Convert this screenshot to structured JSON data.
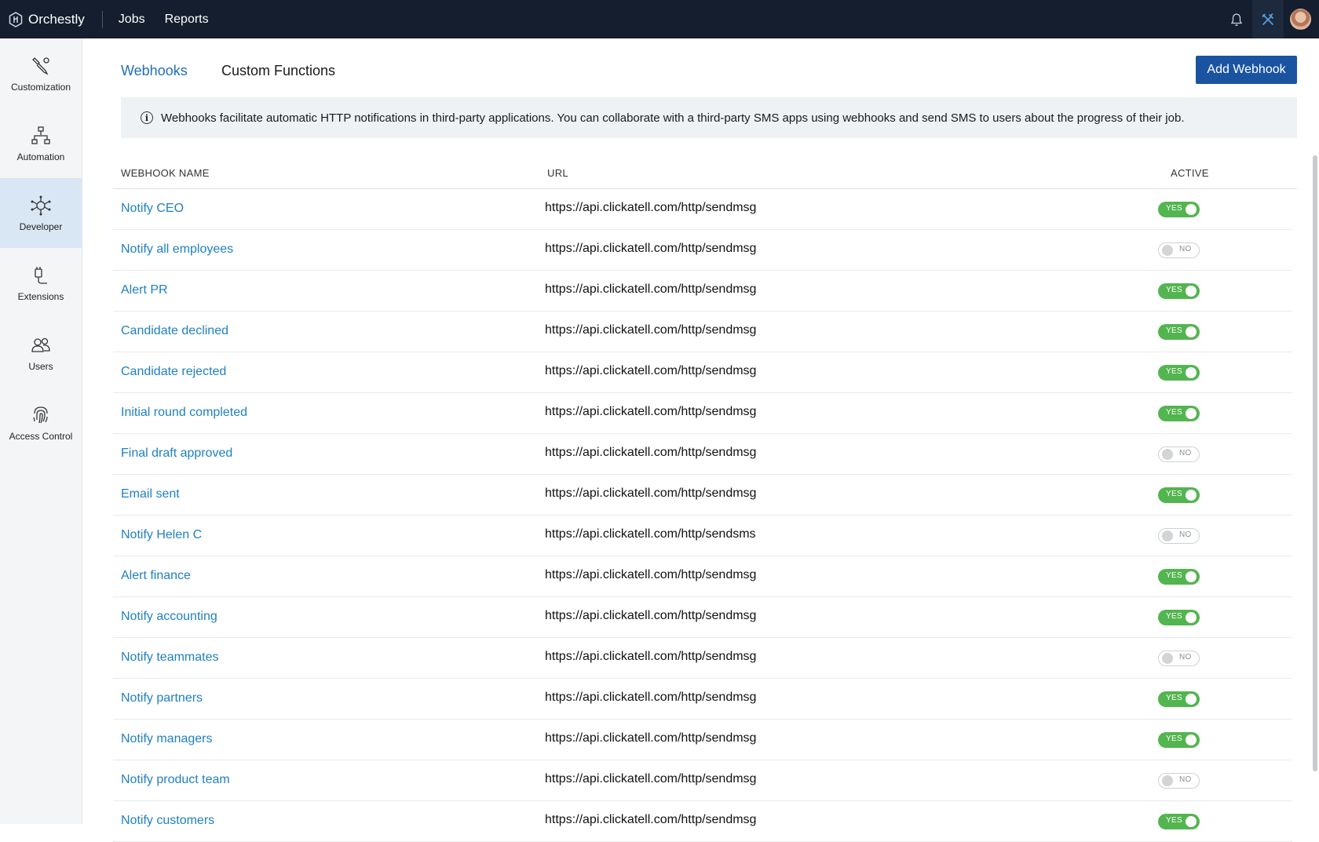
{
  "topbar": {
    "brand": "Orchestly",
    "nav": [
      "Jobs",
      "Reports"
    ]
  },
  "sidebar": {
    "items": [
      {
        "label": "Customization",
        "icon": "customization-icon"
      },
      {
        "label": "Automation",
        "icon": "automation-icon"
      },
      {
        "label": "Developer",
        "icon": "developer-icon",
        "active": true
      },
      {
        "label": "Extensions",
        "icon": "extensions-icon"
      },
      {
        "label": "Users",
        "icon": "users-icon"
      },
      {
        "label": "Access Control",
        "icon": "fingerprint-icon"
      }
    ]
  },
  "tabs": {
    "webhooks": "Webhooks",
    "custom_functions": "Custom Functions"
  },
  "add_button": "Add Webhook",
  "info_text": "Webhooks facilitate automatic HTTP notifications in third-party applications. You can collaborate with a third-party SMS apps using webhooks and send SMS to users about the progress of their job.",
  "table": {
    "headers": {
      "name": "WEBHOOK NAME",
      "url": "URL",
      "active": "ACTIVE"
    },
    "toggle_labels": {
      "on": "YES",
      "off": "NO"
    },
    "rows": [
      {
        "name": "Notify CEO",
        "url": "https://api.clickatell.com/http/sendmsg",
        "active": true
      },
      {
        "name": "Notify all employees",
        "url": "https://api.clickatell.com/http/sendmsg",
        "active": false
      },
      {
        "name": "Alert PR",
        "url": "https://api.clickatell.com/http/sendmsg",
        "active": true
      },
      {
        "name": "Candidate declined",
        "url": "https://api.clickatell.com/http/sendmsg",
        "active": true
      },
      {
        "name": "Candidate rejected",
        "url": "https://api.clickatell.com/http/sendmsg",
        "active": true
      },
      {
        "name": "Initial round completed",
        "url": "https://api.clickatell.com/http/sendmsg",
        "active": true
      },
      {
        "name": "Final draft approved",
        "url": "https://api.clickatell.com/http/sendmsg",
        "active": false
      },
      {
        "name": "Email sent",
        "url": "https://api.clickatell.com/http/sendmsg",
        "active": true
      },
      {
        "name": "Notify Helen C",
        "url": "https://api.clickatell.com/http/sendsms",
        "active": false
      },
      {
        "name": "Alert finance",
        "url": "https://api.clickatell.com/http/sendmsg",
        "active": true
      },
      {
        "name": "Notify accounting",
        "url": "https://api.clickatell.com/http/sendmsg",
        "active": true
      },
      {
        "name": "Notify teammates",
        "url": "https://api.clickatell.com/http/sendmsg",
        "active": false
      },
      {
        "name": "Notify partners",
        "url": "https://api.clickatell.com/http/sendmsg",
        "active": true
      },
      {
        "name": "Notify managers",
        "url": "https://api.clickatell.com/http/sendmsg",
        "active": true
      },
      {
        "name": "Notify product team",
        "url": "https://api.clickatell.com/http/sendmsg",
        "active": false
      },
      {
        "name": "Notify customers",
        "url": "https://api.clickatell.com/http/sendmsg",
        "active": true
      }
    ]
  },
  "colors": {
    "topbar": "#141e2e",
    "accent": "#1a54a0",
    "link": "#1f80c2",
    "toggle_on": "#53b54f"
  }
}
